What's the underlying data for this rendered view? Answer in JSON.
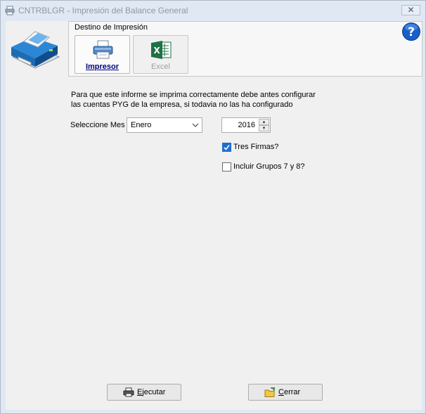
{
  "window": {
    "title": "CNTRBLGR - Impresión del Balance General",
    "close_label": "✕"
  },
  "destination": {
    "group_label": "Destino de Impresión",
    "options": [
      {
        "label": "Impresor",
        "selected": true,
        "enabled": true,
        "icon": "printer-icon"
      },
      {
        "label": "Excel",
        "selected": false,
        "enabled": false,
        "icon": "excel-icon"
      }
    ]
  },
  "info": {
    "line1": "Para que este informe se imprima correctamente debe antes configurar",
    "line2": "las cuentas PYG de la empresa, si todavia no las ha configurado"
  },
  "month": {
    "label": "Seleccione Mes",
    "value": "Enero"
  },
  "year": {
    "value": "2016"
  },
  "options": {
    "tres_firmas": {
      "label": "Tres Firmas?",
      "checked": true
    },
    "incluir_grupos": {
      "label": "Incluir Grupos  7 y 8?",
      "checked": false
    }
  },
  "buttons": {
    "ejecutar": {
      "first": "E",
      "rest": "jecutar"
    },
    "cerrar": {
      "first": "C",
      "rest": "errar"
    }
  },
  "colors": {
    "window_frame": "#dfe8f3",
    "client_bg": "#f0f0f0",
    "check_accent": "#1f6fd0",
    "selected_text": "#00007f",
    "help_blue": "#1a5ec8"
  }
}
